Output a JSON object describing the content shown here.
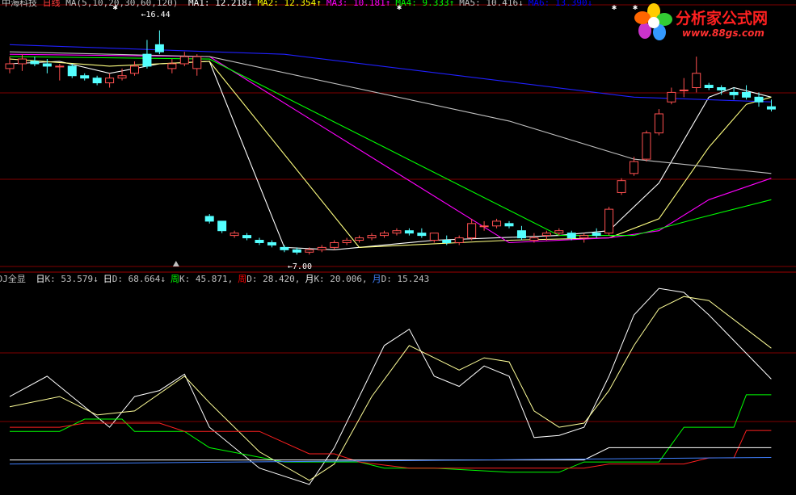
{
  "top_panel": {
    "title": "中海科技",
    "period": "日线",
    "ma_params": "MA(5,10,20,30,60,120)",
    "ma_labels": [
      {
        "label": "MA1:",
        "value": "12.218",
        "arrow": "↓",
        "color": "#ffffff"
      },
      {
        "label": "MA2:",
        "value": "12.354",
        "arrow": "↑",
        "color": "#ffff00"
      },
      {
        "label": "MA3:",
        "value": "10.181",
        "arrow": "↑",
        "color": "#ff00ff"
      },
      {
        "label": "MA4:",
        "value": "9.333",
        "arrow": "↑",
        "color": "#00ff00"
      },
      {
        "label": "MA5:",
        "value": "10.416",
        "arrow": "↓",
        "color": "#c0c0c0"
      },
      {
        "label": "MA6:",
        "value": "13.390",
        "arrow": "↓",
        "color": "#0000ff"
      }
    ],
    "high_marker": "16.44",
    "low_marker": "7.00"
  },
  "bottom_panel": {
    "title": "KDJ全显",
    "indicators": [
      {
        "label": "日K:",
        "value": "53.579",
        "arrow": "↓",
        "color": "#ffffff"
      },
      {
        "label": "日D:",
        "value": "68.664",
        "arrow": "↓",
        "color": "#ffffff"
      },
      {
        "label": "周K:",
        "value": "45.871",
        "arrow": ",",
        "color": "#00ff00"
      },
      {
        "label": "周D:",
        "value": "28.420",
        "arrow": ",",
        "color": "#ff0000"
      },
      {
        "label": "月K:",
        "value": "20.006",
        "arrow": ",",
        "color": "#ffffff"
      },
      {
        "label": "月D:",
        "value": "15.243",
        "arrow": "",
        "color": "#4080ff"
      }
    ]
  },
  "logo": {
    "title": "分析家公式网",
    "url": "www.88gs.com"
  },
  "colors": {
    "background": "#000000",
    "up_candle": "#ff5050",
    "down_candle": "#54ffff",
    "grid": "#800000"
  },
  "chart_data": [
    {
      "type": "candlestick",
      "name": "price",
      "y_range": [
        6.5,
        17.2
      ],
      "candles": [
        [
          14.8,
          15.3,
          14.6,
          15.0
        ],
        [
          15.0,
          15.4,
          14.7,
          15.2
        ],
        [
          15.1,
          15.3,
          14.9,
          15.0
        ],
        [
          15.0,
          15.2,
          14.6,
          14.9
        ],
        [
          14.9,
          15.0,
          14.3,
          14.9
        ],
        [
          14.9,
          15.0,
          14.4,
          14.5
        ],
        [
          14.5,
          14.6,
          14.3,
          14.4
        ],
        [
          14.4,
          14.5,
          14.1,
          14.2
        ],
        [
          14.2,
          14.6,
          14.0,
          14.4
        ],
        [
          14.4,
          14.8,
          14.3,
          14.5
        ],
        [
          14.6,
          15.1,
          14.5,
          14.9
        ],
        [
          15.4,
          16.0,
          14.8,
          14.9
        ],
        [
          15.8,
          16.4,
          15.4,
          15.5
        ],
        [
          14.8,
          15.2,
          14.6,
          15.0
        ],
        [
          15.0,
          15.5,
          14.9,
          15.3
        ],
        [
          14.8,
          15.4,
          14.5,
          15.3
        ],
        [
          8.6,
          8.7,
          8.3,
          8.4
        ],
        [
          8.4,
          8.4,
          7.9,
          8.0
        ],
        [
          7.8,
          8.0,
          7.7,
          7.9
        ],
        [
          7.8,
          7.9,
          7.6,
          7.7
        ],
        [
          7.6,
          7.7,
          7.4,
          7.5
        ],
        [
          7.5,
          7.6,
          7.3,
          7.4
        ],
        [
          7.3,
          7.4,
          7.1,
          7.2
        ],
        [
          7.2,
          7.3,
          7.0,
          7.1
        ],
        [
          7.1,
          7.3,
          7.0,
          7.2
        ],
        [
          7.2,
          7.4,
          7.1,
          7.3
        ],
        [
          7.3,
          7.6,
          7.2,
          7.5
        ],
        [
          7.5,
          7.7,
          7.4,
          7.6
        ],
        [
          7.6,
          7.8,
          7.5,
          7.7
        ],
        [
          7.7,
          7.9,
          7.6,
          7.8
        ],
        [
          7.8,
          8.0,
          7.7,
          7.9
        ],
        [
          7.9,
          8.1,
          7.8,
          8.0
        ],
        [
          8.0,
          8.1,
          7.8,
          7.9
        ],
        [
          7.9,
          8.1,
          7.7,
          7.8
        ],
        [
          7.6,
          7.9,
          7.5,
          7.9
        ],
        [
          7.6,
          7.8,
          7.4,
          7.5
        ],
        [
          7.5,
          7.8,
          7.4,
          7.7
        ],
        [
          7.7,
          8.5,
          7.6,
          8.3
        ],
        [
          8.2,
          8.4,
          8.0,
          8.2
        ],
        [
          8.2,
          8.5,
          8.1,
          8.4
        ],
        [
          8.3,
          8.4,
          8.1,
          8.2
        ],
        [
          8.0,
          8.2,
          7.6,
          7.7
        ],
        [
          7.6,
          7.9,
          7.5,
          7.7
        ],
        [
          7.8,
          8.0,
          7.6,
          7.9
        ],
        [
          7.9,
          8.1,
          7.8,
          8.0
        ],
        [
          7.9,
          8.0,
          7.6,
          7.7
        ],
        [
          7.7,
          7.9,
          7.5,
          7.8
        ],
        [
          7.9,
          8.1,
          7.7,
          7.8
        ],
        [
          7.9,
          9.0,
          7.8,
          8.9
        ],
        [
          9.6,
          10.2,
          9.5,
          10.1
        ],
        [
          10.4,
          11.1,
          10.3,
          10.9
        ],
        [
          11.0,
          12.2,
          10.9,
          12.1
        ],
        [
          12.1,
          13.1,
          12.0,
          12.9
        ],
        [
          13.4,
          14.0,
          13.3,
          13.8
        ],
        [
          13.9,
          14.4,
          13.6,
          13.9
        ],
        [
          14.0,
          15.3,
          13.8,
          14.6
        ],
        [
          14.1,
          14.2,
          13.9,
          14.0
        ],
        [
          14.0,
          14.1,
          13.7,
          13.9
        ],
        [
          13.8,
          14.0,
          13.5,
          13.7
        ],
        [
          13.8,
          14.1,
          13.5,
          13.6
        ],
        [
          13.6,
          13.8,
          13.2,
          13.4
        ],
        [
          13.2,
          13.5,
          13.0,
          13.1
        ]
      ],
      "ma_lines": {
        "MA1": [
          [
            0,
            15.0
          ],
          [
            4,
            15.1
          ],
          [
            8,
            14.6
          ],
          [
            12,
            15.0
          ],
          [
            16,
            15.1
          ],
          [
            22,
            7.3
          ],
          [
            26,
            7.2
          ],
          [
            34,
            7.6
          ],
          [
            44,
            7.8
          ],
          [
            48,
            8.0
          ],
          [
            52,
            10.0
          ],
          [
            56,
            13.6
          ],
          [
            58,
            14.0
          ],
          [
            61,
            13.6
          ]
        ],
        "MA2": [
          [
            0,
            15.2
          ],
          [
            8,
            14.9
          ],
          [
            16,
            15.1
          ],
          [
            28,
            7.3
          ],
          [
            40,
            7.6
          ],
          [
            48,
            7.7
          ],
          [
            52,
            8.5
          ],
          [
            56,
            11.5
          ],
          [
            59,
            13.3
          ],
          [
            61,
            13.6
          ]
        ],
        "MA3": [
          [
            0,
            15.4
          ],
          [
            16,
            15.3
          ],
          [
            40,
            7.5
          ],
          [
            48,
            7.7
          ],
          [
            52,
            8.0
          ],
          [
            56,
            9.3
          ],
          [
            61,
            10.2
          ]
        ],
        "MA4": [
          [
            0,
            15.3
          ],
          [
            16,
            15.2
          ],
          [
            30,
            11.5
          ],
          [
            44,
            7.8
          ],
          [
            50,
            7.8
          ],
          [
            55,
            8.5
          ],
          [
            61,
            9.3
          ]
        ],
        "MA5": [
          [
            0,
            15.5
          ],
          [
            16,
            15.3
          ],
          [
            40,
            12.6
          ],
          [
            50,
            11.0
          ],
          [
            61,
            10.4
          ]
        ],
        "MA6": [
          [
            0,
            15.8
          ],
          [
            22,
            15.4
          ],
          [
            50,
            13.6
          ],
          [
            61,
            13.4
          ]
        ]
      }
    },
    {
      "type": "line",
      "name": "KDJ",
      "y_range": [
        0,
        100
      ],
      "series": [
        {
          "name": "日K",
          "values": [
            [
              0,
              45
            ],
            [
              3,
              55
            ],
            [
              6,
              40
            ],
            [
              8,
              30
            ],
            [
              10,
              45
            ],
            [
              12,
              48
            ],
            [
              14,
              56
            ],
            [
              16,
              30
            ],
            [
              20,
              10
            ],
            [
              24,
              2
            ],
            [
              26,
              20
            ],
            [
              30,
              70
            ],
            [
              32,
              78
            ],
            [
              34,
              55
            ],
            [
              36,
              50
            ],
            [
              38,
              60
            ],
            [
              40,
              55
            ],
            [
              42,
              25
            ],
            [
              44,
              26
            ],
            [
              46,
              30
            ],
            [
              48,
              55
            ],
            [
              50,
              85
            ],
            [
              52,
              98
            ],
            [
              54,
              96
            ],
            [
              56,
              85
            ],
            [
              61,
              53.6
            ]
          ]
        },
        {
          "name": "日D",
          "values": [
            [
              0,
              40
            ],
            [
              4,
              45
            ],
            [
              7,
              36
            ],
            [
              10,
              38
            ],
            [
              14,
              55
            ],
            [
              16,
              42
            ],
            [
              20,
              18
            ],
            [
              24,
              4
            ],
            [
              26,
              12
            ],
            [
              29,
              45
            ],
            [
              32,
              70
            ],
            [
              34,
              64
            ],
            [
              36,
              58
            ],
            [
              38,
              64
            ],
            [
              40,
              62
            ],
            [
              42,
              38
            ],
            [
              44,
              30
            ],
            [
              46,
              32
            ],
            [
              48,
              48
            ],
            [
              50,
              70
            ],
            [
              52,
              88
            ],
            [
              54,
              94
            ],
            [
              56,
              92
            ],
            [
              61,
              68.7
            ]
          ]
        },
        {
          "name": "周K",
          "values": [
            [
              0,
              28
            ],
            [
              4,
              28
            ],
            [
              6,
              34
            ],
            [
              9,
              34
            ],
            [
              10,
              28
            ],
            [
              14,
              28
            ],
            [
              16,
              20
            ],
            [
              22,
              13
            ],
            [
              28,
              13
            ],
            [
              30,
              10
            ],
            [
              34,
              10
            ],
            [
              40,
              8
            ],
            [
              44,
              8
            ],
            [
              46,
              13
            ],
            [
              52,
              13
            ],
            [
              54,
              30
            ],
            [
              58,
              30
            ],
            [
              59,
              45.9
            ],
            [
              61,
              45.9
            ]
          ]
        },
        {
          "name": "周D",
          "values": [
            [
              0,
              30
            ],
            [
              4,
              30
            ],
            [
              6,
              32
            ],
            [
              12,
              32
            ],
            [
              14,
              28
            ],
            [
              20,
              28
            ],
            [
              24,
              17
            ],
            [
              26,
              17
            ],
            [
              28,
              13
            ],
            [
              32,
              10
            ],
            [
              36,
              10
            ],
            [
              40,
              10
            ],
            [
              46,
              10
            ],
            [
              48,
              12
            ],
            [
              54,
              12
            ],
            [
              56,
              15
            ],
            [
              58,
              15
            ],
            [
              59,
              28.4
            ],
            [
              61,
              28.4
            ]
          ]
        },
        {
          "name": "月K",
          "values": [
            [
              0,
              14
            ],
            [
              26,
              14
            ],
            [
              46,
              14
            ],
            [
              48,
              20
            ],
            [
              61,
              20
            ]
          ]
        },
        {
          "name": "月D",
          "values": [
            [
              0,
              12
            ],
            [
              61,
              15.2
            ]
          ]
        }
      ]
    }
  ]
}
